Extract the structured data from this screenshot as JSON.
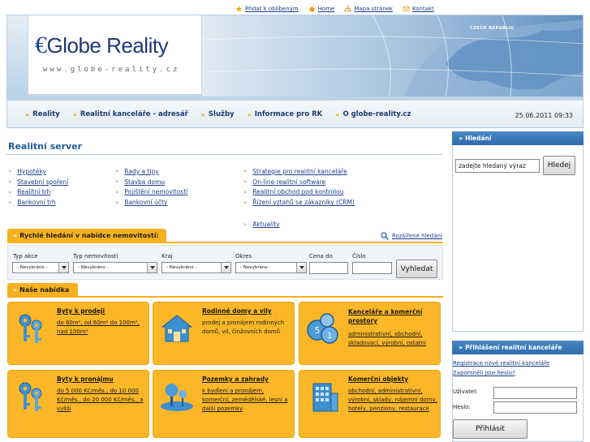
{
  "toplinks": [
    {
      "label": "Přidat k oblíbeným",
      "icon": "star-icon"
    },
    {
      "label": "Home",
      "icon": "house-icon"
    },
    {
      "label": "Mapa stránek",
      "icon": "sitemap-icon"
    },
    {
      "label": "Kontakt",
      "icon": "envelope-icon"
    }
  ],
  "header": {
    "logo_prefix": "€",
    "logo_title": "Globe Reality",
    "logo_url": "www.globe-reality.cz",
    "map_label": "CZECH REPUBLIC"
  },
  "nav": {
    "items": [
      "Reality",
      "Realitní kanceláře - adresář",
      "Služby",
      "Informace pro RK",
      "O globe-reality.cz"
    ],
    "datetime": "25.06.2011 09:33"
  },
  "main": {
    "title": "Realitní server",
    "col1": [
      "Hypotéky",
      "Stavební spoření",
      "Realitní trh",
      "Bankovní trh"
    ],
    "col2": [
      "Rady a tipy",
      "Stavba domu",
      "Pojištění nemovitostí",
      "Bankovní účty"
    ],
    "col3": [
      "Strategie pro realitní kanceláře",
      "On-line realitní software",
      "Realitní obchod pod kontrolou",
      "Řízení vztahů se zákazníky (CRM)"
    ],
    "col3_extra": "Aktuality"
  },
  "quicksearch": {
    "title": "Rychlé hledání v nabídce nemovitostí:",
    "advanced": "Rozšířené hledání",
    "labels": {
      "typ_akce": "Typ akce",
      "typ_nem": "Typ nemovitosti",
      "kraj": "Kraj",
      "okres": "Okres",
      "cena": "Cena do",
      "cislo": "Číslo"
    },
    "select_value": "- Nevybráno -",
    "button": "Vyhledat"
  },
  "offer": {
    "title": "Naše nabídka",
    "cards": [
      {
        "title": "Byty k prodeji",
        "body": "do 60m², od 60m² do 100m², nad 100m²",
        "icon": "keys-icon"
      },
      {
        "title": "Rodinné domy a vily",
        "body": "prodej a pronájem rodinných domů, vil, činžovních domů",
        "icon": "house-icon"
      },
      {
        "title": "Kanceláře a komerční prostory",
        "body": "administrativní, obchodní, skladovací, výrobní, ostatní",
        "icon": "coins-icon"
      },
      {
        "title": "Byty k pronájmu",
        "body": "do 5 000 Kč/měs., do 10 000 Kč/měs., do 20 000 Kč/měs., a vyšší",
        "icon": "keys-icon"
      },
      {
        "title": "Pozemky a zahrady",
        "body": "k bydlení a pronájem, komerční, zemědělské, lesní a další pozemky",
        "icon": "tree-icon"
      },
      {
        "title": "Komerční objekty",
        "body": "obchodní, administrativní, výrobní, sklady, nájemní domy, hotely, penziony, restaurace",
        "icon": "building-icon"
      }
    ]
  },
  "sidebar": {
    "search_title": "Hledání",
    "search_value": "zadejte hledaný výraz",
    "search_button": "Hledej",
    "login_title": "Přihlášení realitní kanceláře",
    "register": "Registrace nové realitní kanceláře",
    "forgot": "Zapomněli jste heslo?",
    "user_label": "Uživatel:",
    "pass_label": "Heslo:",
    "login_button": "Přihlásit"
  },
  "colors": {
    "accent": "#f6b11e",
    "brand": "#1f3a74",
    "sidebar_head": "#3a78b9"
  }
}
